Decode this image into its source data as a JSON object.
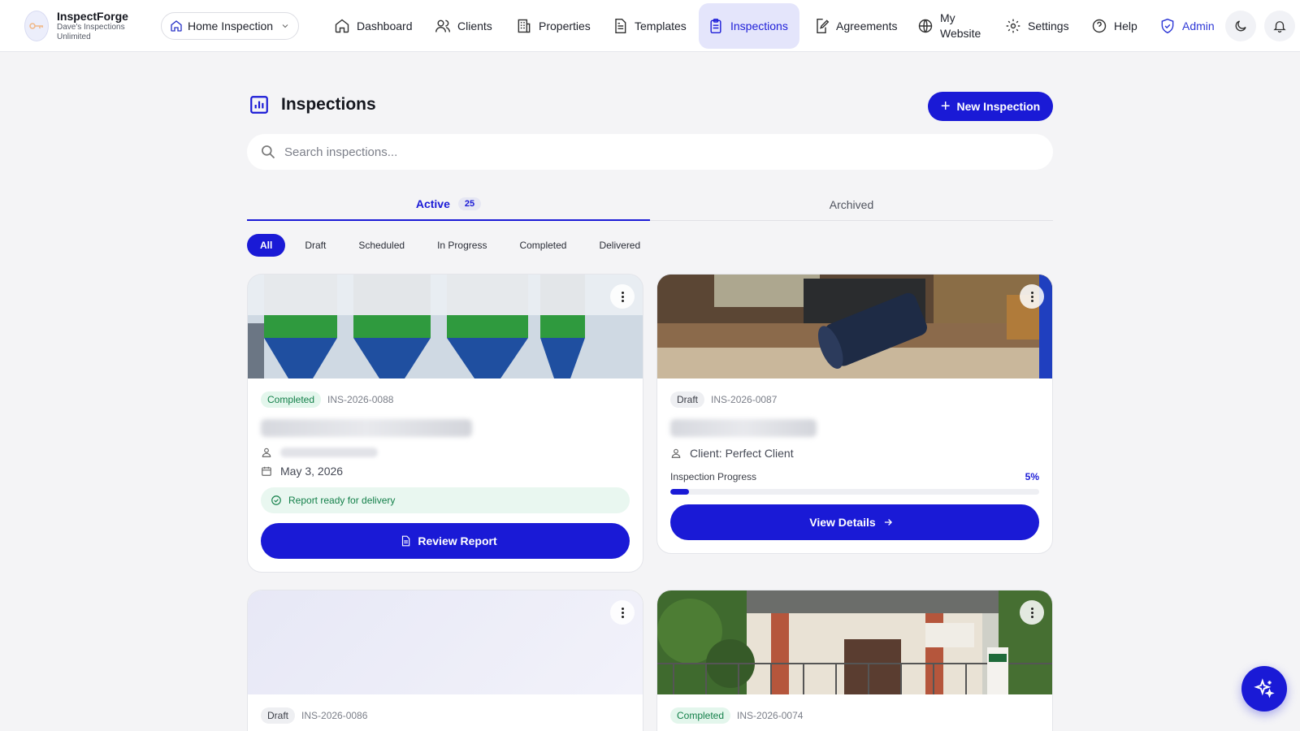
{
  "brand": {
    "name": "InspectForge",
    "subtitle": "Dave's Inspections Unlimited"
  },
  "selector": {
    "label": "Home Inspection"
  },
  "nav": [
    {
      "label": "Dashboard",
      "icon": "home-icon"
    },
    {
      "label": "Clients",
      "icon": "users-icon"
    },
    {
      "label": "Properties",
      "icon": "building-icon"
    },
    {
      "label": "Templates",
      "icon": "document-icon"
    },
    {
      "label": "Inspections",
      "icon": "clipboard-icon",
      "active": true
    },
    {
      "label": "Agreements",
      "icon": "edit-document-icon"
    },
    {
      "label": "My Website",
      "icon": "globe-icon"
    },
    {
      "label": "Settings",
      "icon": "gear-icon"
    },
    {
      "label": "Help",
      "icon": "help-circle-icon"
    },
    {
      "label": "Admin",
      "icon": "shield-icon"
    }
  ],
  "page": {
    "title": "Inspections",
    "new_button": "New Inspection",
    "search_placeholder": "Search inspections..."
  },
  "tabs": {
    "active_label": "Active",
    "active_count": "25",
    "archived_label": "Archived"
  },
  "filters": [
    "All",
    "Draft",
    "Scheduled",
    "In Progress",
    "Completed",
    "Delivered"
  ],
  "cards": [
    {
      "status": "Completed",
      "id": "INS-2026-0088",
      "date": "May 3, 2026",
      "ready_text": "Report ready for delivery",
      "action": "Review Report",
      "image": "silos"
    },
    {
      "status": "Draft",
      "id": "INS-2026-0087",
      "client": "Client: Perfect Client",
      "progress_label": "Inspection Progress",
      "progress_text": "5%",
      "progress_value": 0.05,
      "action": "View Details",
      "image": "desk"
    },
    {
      "status": "Draft",
      "id": "INS-2026-0086",
      "image": "placeholder"
    },
    {
      "status": "Completed",
      "id": "INS-2026-0074",
      "image": "house"
    }
  ],
  "colors": {
    "accent": "#1a1ad6",
    "success": "#14804a",
    "success_bg": "#e3f6ec"
  }
}
